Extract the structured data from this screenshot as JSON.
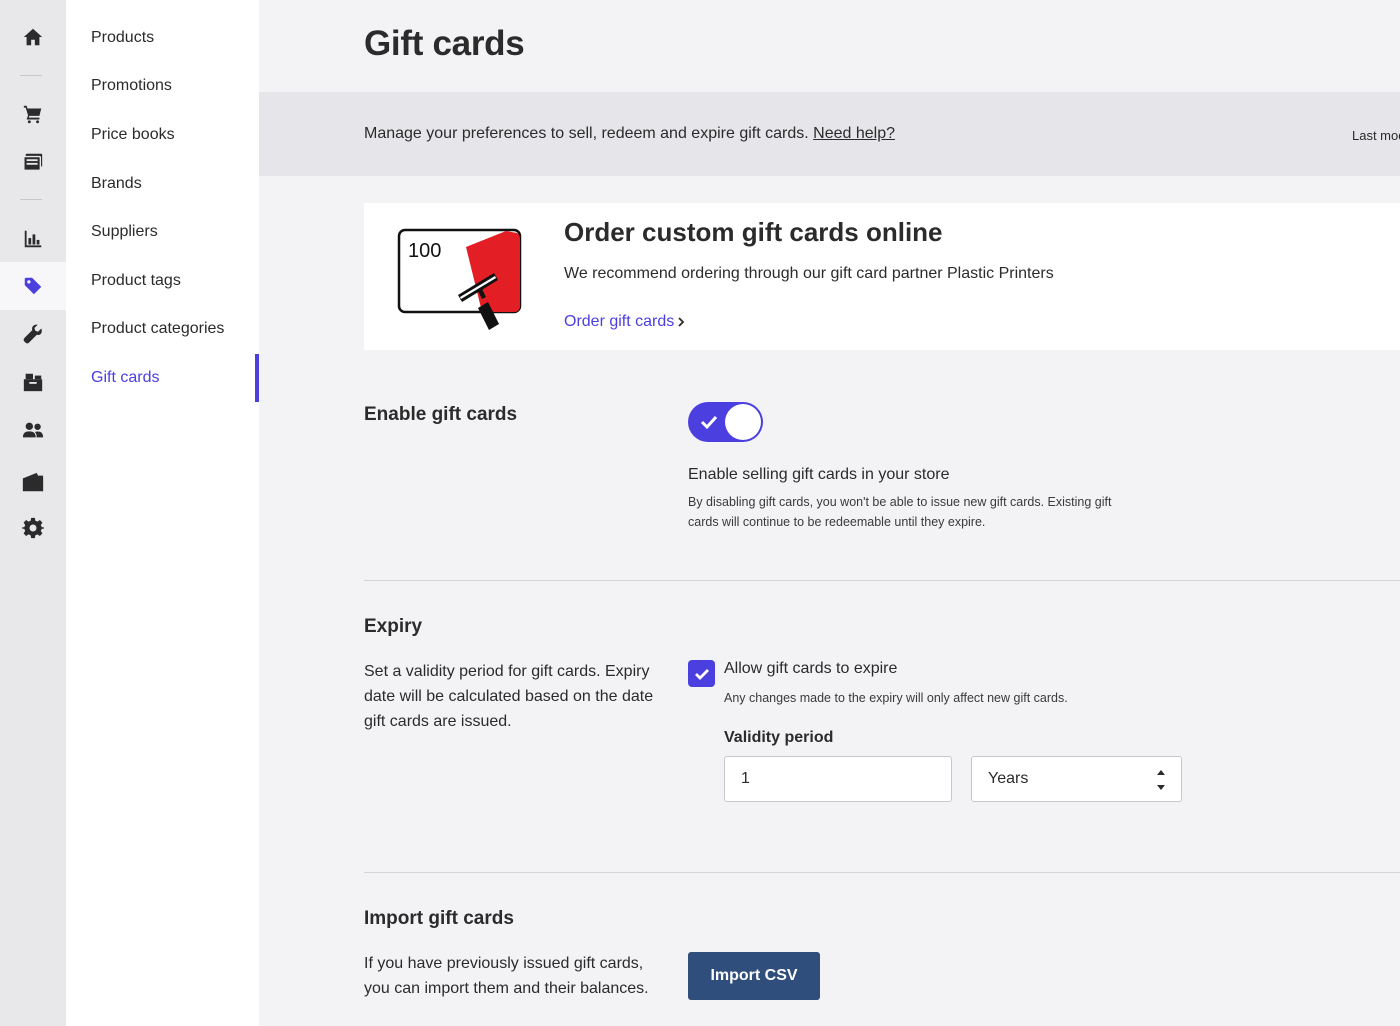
{
  "rail": {
    "items": [
      {
        "icon": "home-icon"
      },
      {
        "icon": "cart-icon"
      },
      {
        "icon": "register-icon"
      },
      {
        "icon": "reports-icon"
      },
      {
        "icon": "tag-icon",
        "active": true
      },
      {
        "icon": "wrench-icon"
      },
      {
        "icon": "inventory-icon"
      },
      {
        "icon": "customers-icon"
      },
      {
        "icon": "folder-icon"
      },
      {
        "icon": "gear-icon"
      }
    ]
  },
  "subnav": {
    "items": [
      {
        "label": "Products"
      },
      {
        "label": "Promotions"
      },
      {
        "label": "Price books"
      },
      {
        "label": "Brands"
      },
      {
        "label": "Suppliers"
      },
      {
        "label": "Product tags"
      },
      {
        "label": "Product categories"
      },
      {
        "label": "Gift cards",
        "active": true
      }
    ]
  },
  "page": {
    "title": "Gift cards"
  },
  "banner": {
    "text": "Manage your preferences to sell, redeem and expire gift cards.",
    "help_link": "Need help?",
    "right_text": "Last mod"
  },
  "promo": {
    "card_value": "100",
    "title": "Order custom gift cards online",
    "description": "We recommend ordering through our gift card partner Plastic Printers",
    "link": "Order gift cards"
  },
  "enable": {
    "title": "Enable gift cards",
    "toggle_on": true,
    "option_label": "Enable selling gift cards in your store",
    "option_help_line1": "By disabling gift cards, you won't be able to issue new gift cards. Existing gift",
    "option_help_line2": "cards will continue to be redeemable until they expire."
  },
  "expiry": {
    "title": "Expiry",
    "desc_line1": "Set a validity period for gift cards. Expiry",
    "desc_line2": "date will be calculated based on the date",
    "desc_line3": "gift cards are issued.",
    "checkbox_checked": true,
    "checkbox_label": "Allow gift cards to expire",
    "checkbox_help": "Any changes made to the expiry will only affect new gift cards.",
    "validity_label": "Validity period",
    "validity_value": "1",
    "unit_value": "Years"
  },
  "import": {
    "title": "Import gift cards",
    "desc_line1": "If you have previously issued gift cards,",
    "desc_line2": "you can import them and their balances.",
    "button": "Import CSV"
  },
  "colors": {
    "accent": "#4b3fe0",
    "button": "#2f4e7b",
    "rail": "#e8e7ea",
    "background": "#f3f2f5"
  }
}
